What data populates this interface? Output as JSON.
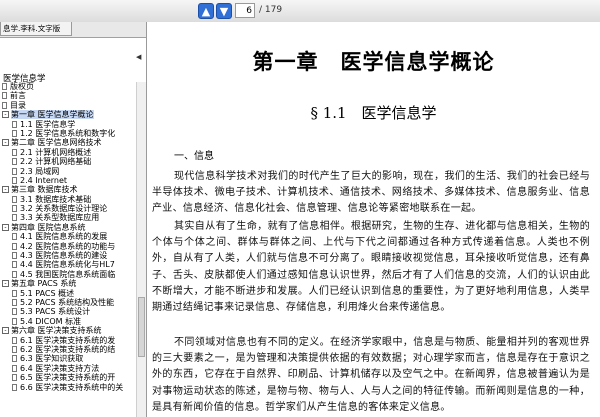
{
  "toolbar": {
    "prev_icon": "arrow-up-icon",
    "next_icon": "arrow-down-icon",
    "page_value": "6",
    "page_total": "/ 179"
  },
  "sidebar": {
    "tab_label": "息学.李科.文字版",
    "root": "医学信息学",
    "items": [
      {
        "level": 0,
        "toggle": "",
        "label": "版权页"
      },
      {
        "level": 0,
        "toggle": "",
        "label": "前言"
      },
      {
        "level": 0,
        "toggle": "",
        "label": "目录"
      },
      {
        "level": 0,
        "toggle": "-",
        "label": "第一章  医学信息学概论",
        "highlight": true
      },
      {
        "level": 1,
        "toggle": "",
        "label": "1.1  医学信息学"
      },
      {
        "level": 1,
        "toggle": "",
        "label": "1.2  医学信息系统和数字化"
      },
      {
        "level": 0,
        "toggle": "-",
        "label": "第二章  医学信息网络技术"
      },
      {
        "level": 1,
        "toggle": "",
        "label": "2.1  计算机网络概述"
      },
      {
        "level": 1,
        "toggle": "",
        "label": "2.2  计算机网络基础"
      },
      {
        "level": 1,
        "toggle": "",
        "label": "2.3  局域网"
      },
      {
        "level": 1,
        "toggle": "",
        "label": "2.4  Internet"
      },
      {
        "level": 0,
        "toggle": "-",
        "label": "第三章  数据库技术"
      },
      {
        "level": 1,
        "toggle": "",
        "label": "3.1  数据库技术基础"
      },
      {
        "level": 1,
        "toggle": "",
        "label": "3.2  关系数据库设计理论"
      },
      {
        "level": 1,
        "toggle": "",
        "label": "3.3  关系型数据库应用"
      },
      {
        "level": 0,
        "toggle": "-",
        "label": "第四章  医院信息系统"
      },
      {
        "level": 1,
        "toggle": "",
        "label": "4.1  医院信息系统的发展"
      },
      {
        "level": 1,
        "toggle": "",
        "label": "4.2  医院信息系统的功能与"
      },
      {
        "level": 1,
        "toggle": "",
        "label": "4.3  医院信息系统的建设"
      },
      {
        "level": 1,
        "toggle": "",
        "label": "4.4  医院信息系统化与HL7"
      },
      {
        "level": 1,
        "toggle": "",
        "label": "4.5  我国医院信息系统面临"
      },
      {
        "level": 0,
        "toggle": "-",
        "label": "第五章  PACS 系统"
      },
      {
        "level": 1,
        "toggle": "",
        "label": "5.1  PACS 概述"
      },
      {
        "level": 1,
        "toggle": "",
        "label": "5.2  PACS 系统结构及性能"
      },
      {
        "level": 1,
        "toggle": "",
        "label": "5.3  PACS 系统设计"
      },
      {
        "level": 1,
        "toggle": "",
        "label": "5.4  DICOM 标准"
      },
      {
        "level": 0,
        "toggle": "-",
        "label": "第六章  医学决策支持系统"
      },
      {
        "level": 1,
        "toggle": "",
        "label": "6.1  医学决策支持系统的发"
      },
      {
        "level": 1,
        "toggle": "",
        "label": "6.2  医学决策支持系统的结"
      },
      {
        "level": 1,
        "toggle": "",
        "label": "6.3  医学知识获取"
      },
      {
        "level": 1,
        "toggle": "",
        "label": "6.4  医学决策支持方法"
      },
      {
        "level": 1,
        "toggle": "",
        "label": "6.5  医学决策支持系统的开"
      },
      {
        "level": 1,
        "toggle": "",
        "label": "6.6  医学决策支持系统中的关"
      }
    ]
  },
  "document": {
    "chapter_title": "第一章　医学信息学概论",
    "section_title": "§ 1.1　医学信息学",
    "subheading": "一、信息",
    "paragraph_1": "现代信息科学技术对我们的时代产生了巨大的影响，现在，我们的生活、我们的社会已经与半导体技术、微电子技术、计算机技术、通信技术、网络技术、多媒体技术、信息服务业、信息产业、信息经济、信息化社会、信息管理、信息论等紧密地联系在一起。",
    "paragraph_2": "其实自从有了生命，就有了信息相伴。根据研究，生物的生存、进化都与信息相关，生物的个体与个体之间、群体与群体之间、上代与下代之间都通过各种方式传递着信息。人类也不例外，自从有了人类，人们就与信息不可分离了。眼睛接收视觉信息，耳朵接收听觉信息，还有鼻子、舌头、皮肤都使人们通过感知信息认识世界，然后才有了人们信息的交流，人们的认识由此不断增大，才能不断进步和发展。人们已经认识到信息的重要性，为了更好地利用信息，人类早期通过结绳记事来记录信息、存储信息，利用烽火台来传递信息。",
    "paragraph_3": "不同领域对信息也有不同的定义。在经济学家眼中，信息是与物质、能量相并列的客观世界的三大要素之一，是为管理和决策提供依据的有效数据；对心理学家而言，信息是存在于意识之外的东西，它存在于自然界、印刷品、计算机储存以及空气之中。在新闻界，信息被普遍认为是对事物运动状态的陈述，是物与物、物与人、人与人之间的特征传输。而新闻则是信息的一种，是具有新闻价值的信息。哲学家们从产生信息的客体来定义信息。"
  }
}
